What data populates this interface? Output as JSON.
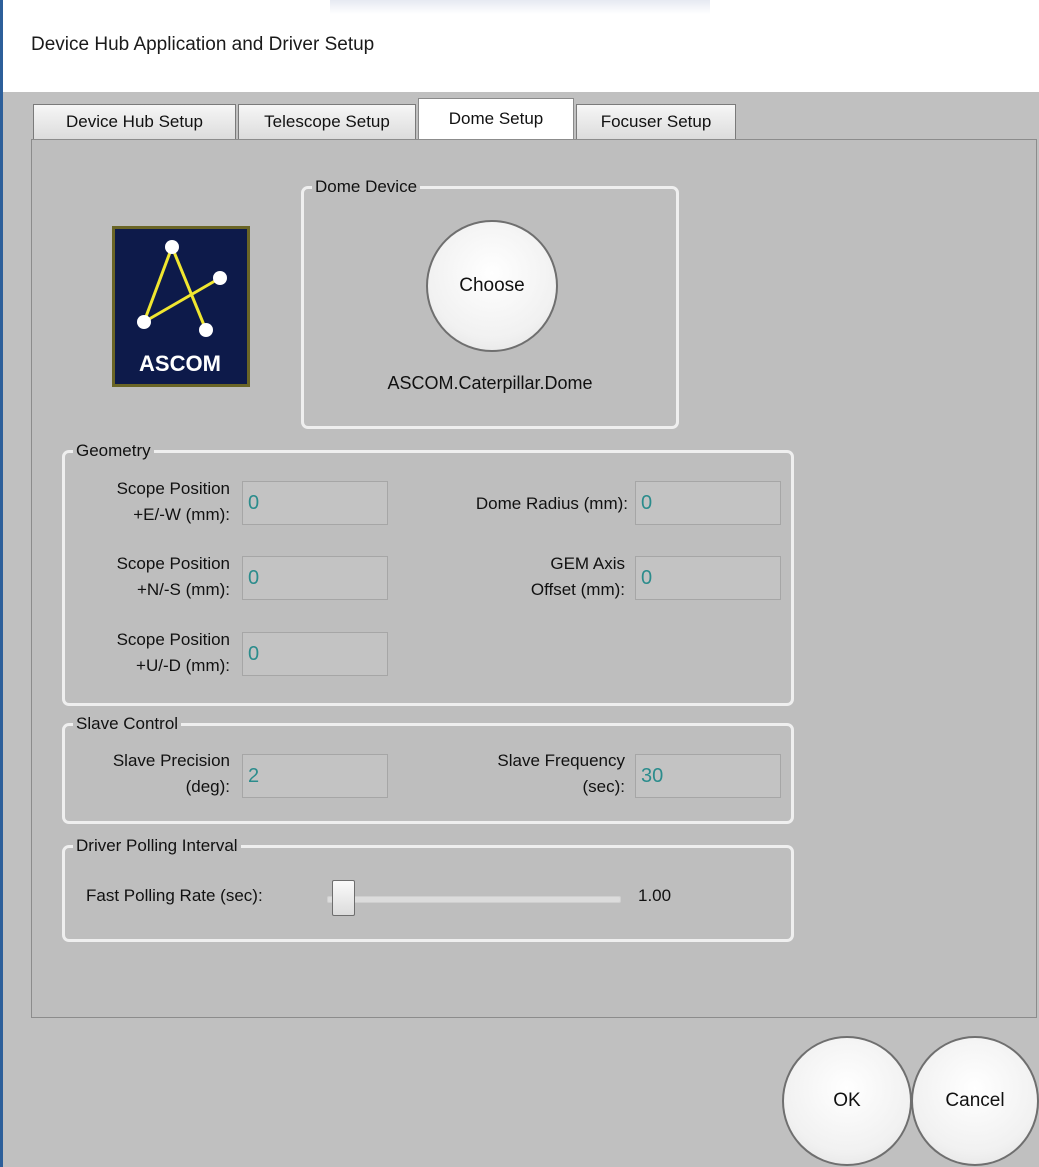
{
  "window": {
    "title": "Device Hub Application and Driver Setup"
  },
  "tabs": [
    {
      "label": "Device Hub Setup",
      "active": false
    },
    {
      "label": "Telescope Setup",
      "active": false
    },
    {
      "label": "Dome Setup",
      "active": true
    },
    {
      "label": "Focuser Setup",
      "active": false
    }
  ],
  "logo": {
    "text": "ASCOM",
    "icon": "ascom-logo-icon",
    "background": "#0d1a4a",
    "line_color": "#f0e630"
  },
  "dome_device": {
    "legend": "Dome Device",
    "choose_label": "Choose",
    "device_name": "ASCOM.Caterpillar.Dome"
  },
  "geometry": {
    "legend": "Geometry",
    "fields": [
      {
        "label_line1": "Scope Position",
        "label_line2": "+E/-W (mm):",
        "value": "0"
      },
      {
        "label_line1": "Scope Position",
        "label_line2": "+N/-S (mm):",
        "value": "0"
      },
      {
        "label_line1": "Scope Position",
        "label_line2": "+U/-D (mm):",
        "value": "0"
      },
      {
        "label_line1": "Dome Radius (mm):",
        "label_line2": "",
        "value": "0"
      },
      {
        "label_line1": "GEM Axis",
        "label_line2": "Offset (mm):",
        "value": "0"
      }
    ]
  },
  "slave_control": {
    "legend": "Slave Control",
    "precision": {
      "label_line1": "Slave Precision",
      "label_line2": "(deg):",
      "value": "2"
    },
    "frequency": {
      "label_line1": "Slave Frequency",
      "label_line2": "(sec):",
      "value": "30"
    }
  },
  "polling": {
    "legend": "Driver Polling Interval",
    "label": "Fast Polling Rate (sec):",
    "value_text": "1.00",
    "slider_fraction": 0.0
  },
  "buttons": {
    "ok": "OK",
    "cancel": "Cancel"
  },
  "colors": {
    "input_text": "#2b8c8c",
    "window_bg": "#c0c0c0",
    "accent_edge": "#2d5f9a"
  }
}
